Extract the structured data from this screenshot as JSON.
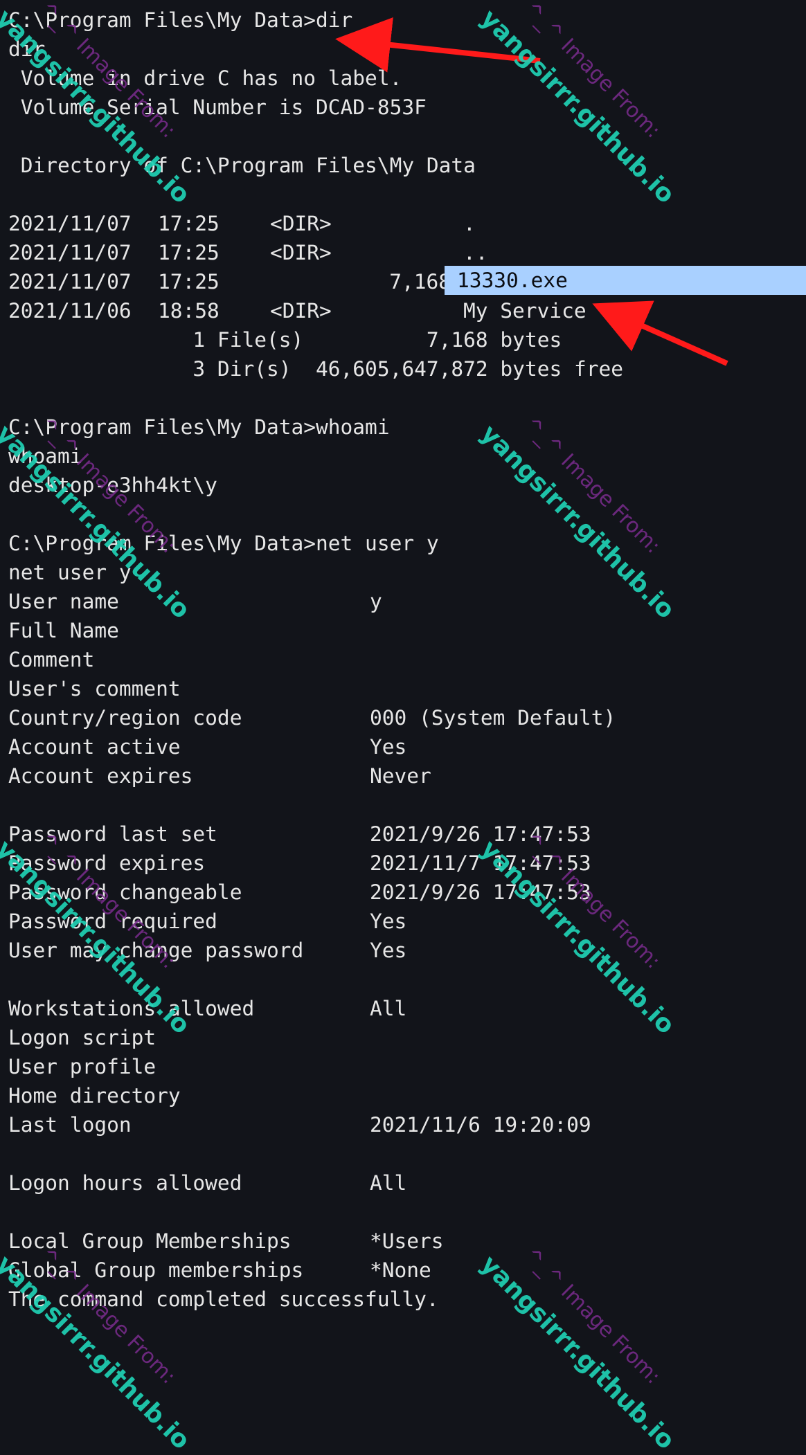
{
  "terminal": {
    "lines": [
      {
        "text": "C:\\Program Files\\My Data>dir"
      },
      {
        "text": "dir"
      },
      {
        "text": " Volume in drive C has no label."
      },
      {
        "text": " Volume Serial Number is DCAD-853F"
      },
      {
        "text": ""
      },
      {
        "text": " Directory of C:\\Program Files\\My Data"
      },
      {
        "text": ""
      },
      {
        "date": "2021/11/07",
        "time": "17:25",
        "type": "<DIR>",
        "size": "",
        "name": "."
      },
      {
        "date": "2021/11/07",
        "time": "17:25",
        "type": "<DIR>",
        "size": "",
        "name": ".."
      },
      {
        "date": "2021/11/07",
        "time": "17:25",
        "type": "",
        "size": "7,168",
        "name": "13330.exe"
      },
      {
        "date": "2021/11/06",
        "time": "18:58",
        "type": "<DIR>",
        "size": "",
        "name": "My Service"
      },
      {
        "text": "               1 File(s)          7,168 bytes"
      },
      {
        "text": "               3 Dir(s)  46,605,647,872 bytes free"
      },
      {
        "text": ""
      },
      {
        "text": "C:\\Program Files\\My Data>whoami"
      },
      {
        "text": "whoami"
      },
      {
        "text": "desktop-e3hh4kt\\y"
      },
      {
        "text": ""
      },
      {
        "text": "C:\\Program Files\\My Data>net user y"
      },
      {
        "text": "net user y"
      },
      {
        "key": "User name",
        "value": "y"
      },
      {
        "key": "Full Name",
        "value": ""
      },
      {
        "key": "Comment",
        "value": ""
      },
      {
        "key": "User's comment",
        "value": ""
      },
      {
        "key": "Country/region code",
        "value": "000 (System Default)"
      },
      {
        "key": "Account active",
        "value": "Yes"
      },
      {
        "key": "Account expires",
        "value": "Never"
      },
      {
        "text": ""
      },
      {
        "key": "Password last set",
        "value": "2021/9/26 17:47:53"
      },
      {
        "key": "Password expires",
        "value": "2021/11/7 17:47:53"
      },
      {
        "key": "Password changeable",
        "value": "2021/9/26 17:47:53"
      },
      {
        "key": "Password required",
        "value": "Yes"
      },
      {
        "key": "User may change password",
        "value": "Yes"
      },
      {
        "text": ""
      },
      {
        "key": "Workstations allowed",
        "value": "All"
      },
      {
        "key": "Logon script",
        "value": ""
      },
      {
        "key": "User profile",
        "value": ""
      },
      {
        "key": "Home directory",
        "value": ""
      },
      {
        "key": "Last logon",
        "value": "2021/11/6 19:20:09"
      },
      {
        "text": ""
      },
      {
        "key": "Logon hours allowed",
        "value": "All"
      },
      {
        "text": ""
      },
      {
        "key": "Local Group Memberships",
        "value": "*Users"
      },
      {
        "key": "Global Group memberships",
        "value": "*None"
      },
      {
        "text": "The command completed successfully."
      }
    ],
    "highlight": "13330.exe"
  },
  "watermark": {
    "small": "^_^ Image From:",
    "big": "yangsirrr.github.io"
  },
  "colors": {
    "background": "#12141a",
    "text": "#e6e6e6",
    "selection": "#a9d0ff",
    "arrow": "#ff1a1a",
    "watermark_big": "#20d1b5",
    "watermark_small": "#7b2c8f"
  }
}
